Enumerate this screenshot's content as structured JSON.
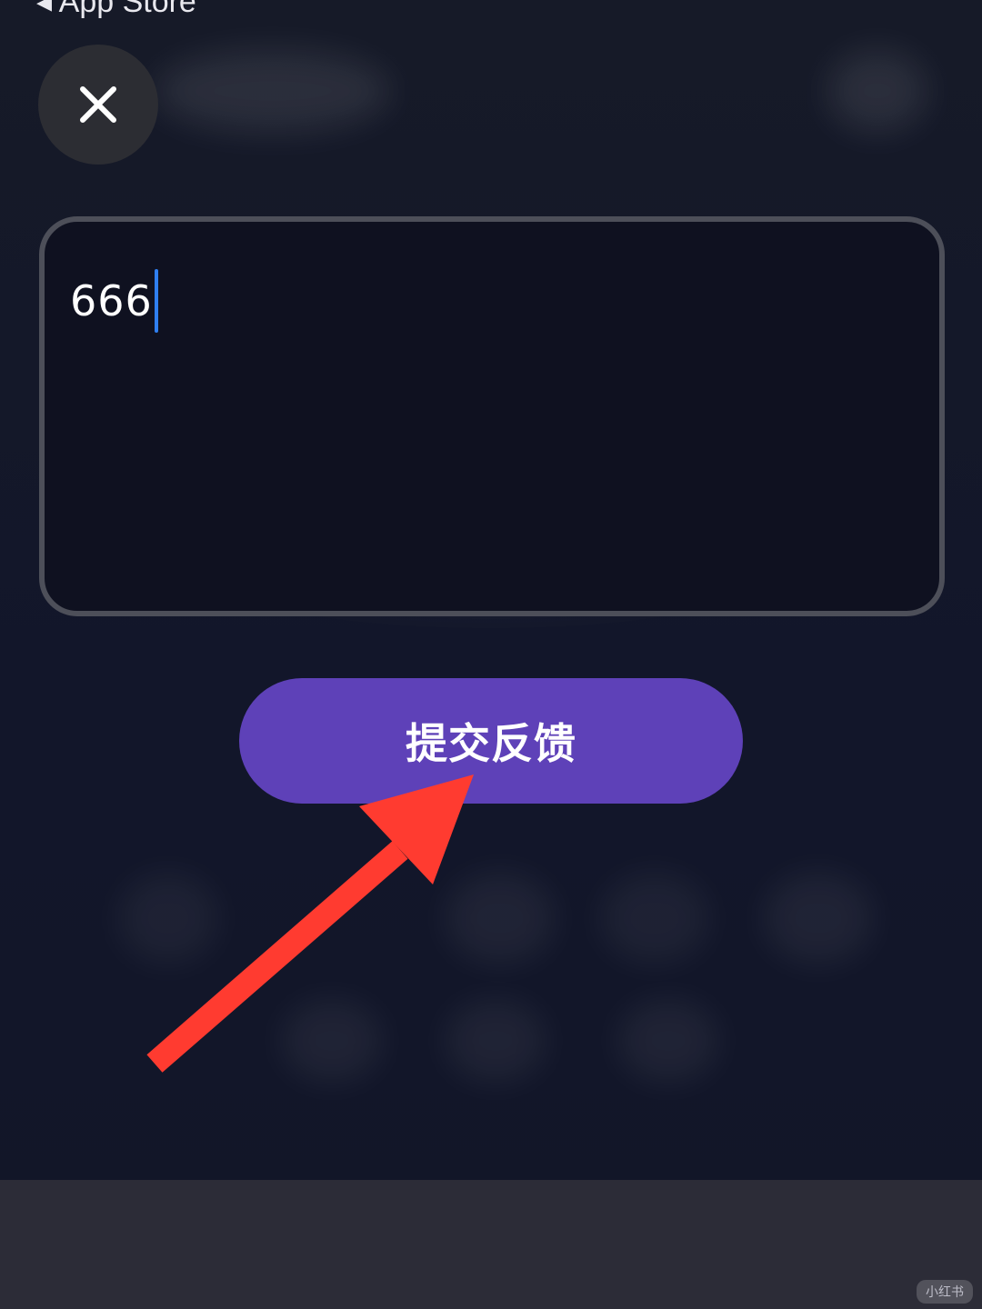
{
  "status_bar": {
    "back_label": "◂ App Store"
  },
  "feedback": {
    "close_icon": "close-icon",
    "input_value": "666",
    "submit_label": "提交反馈"
  },
  "annotation": {
    "arrow_color": "#ff3b30"
  },
  "colors": {
    "background": "#131726",
    "accent": "#5e41b8",
    "caret": "#2f7ff0"
  },
  "watermark": "小红书"
}
